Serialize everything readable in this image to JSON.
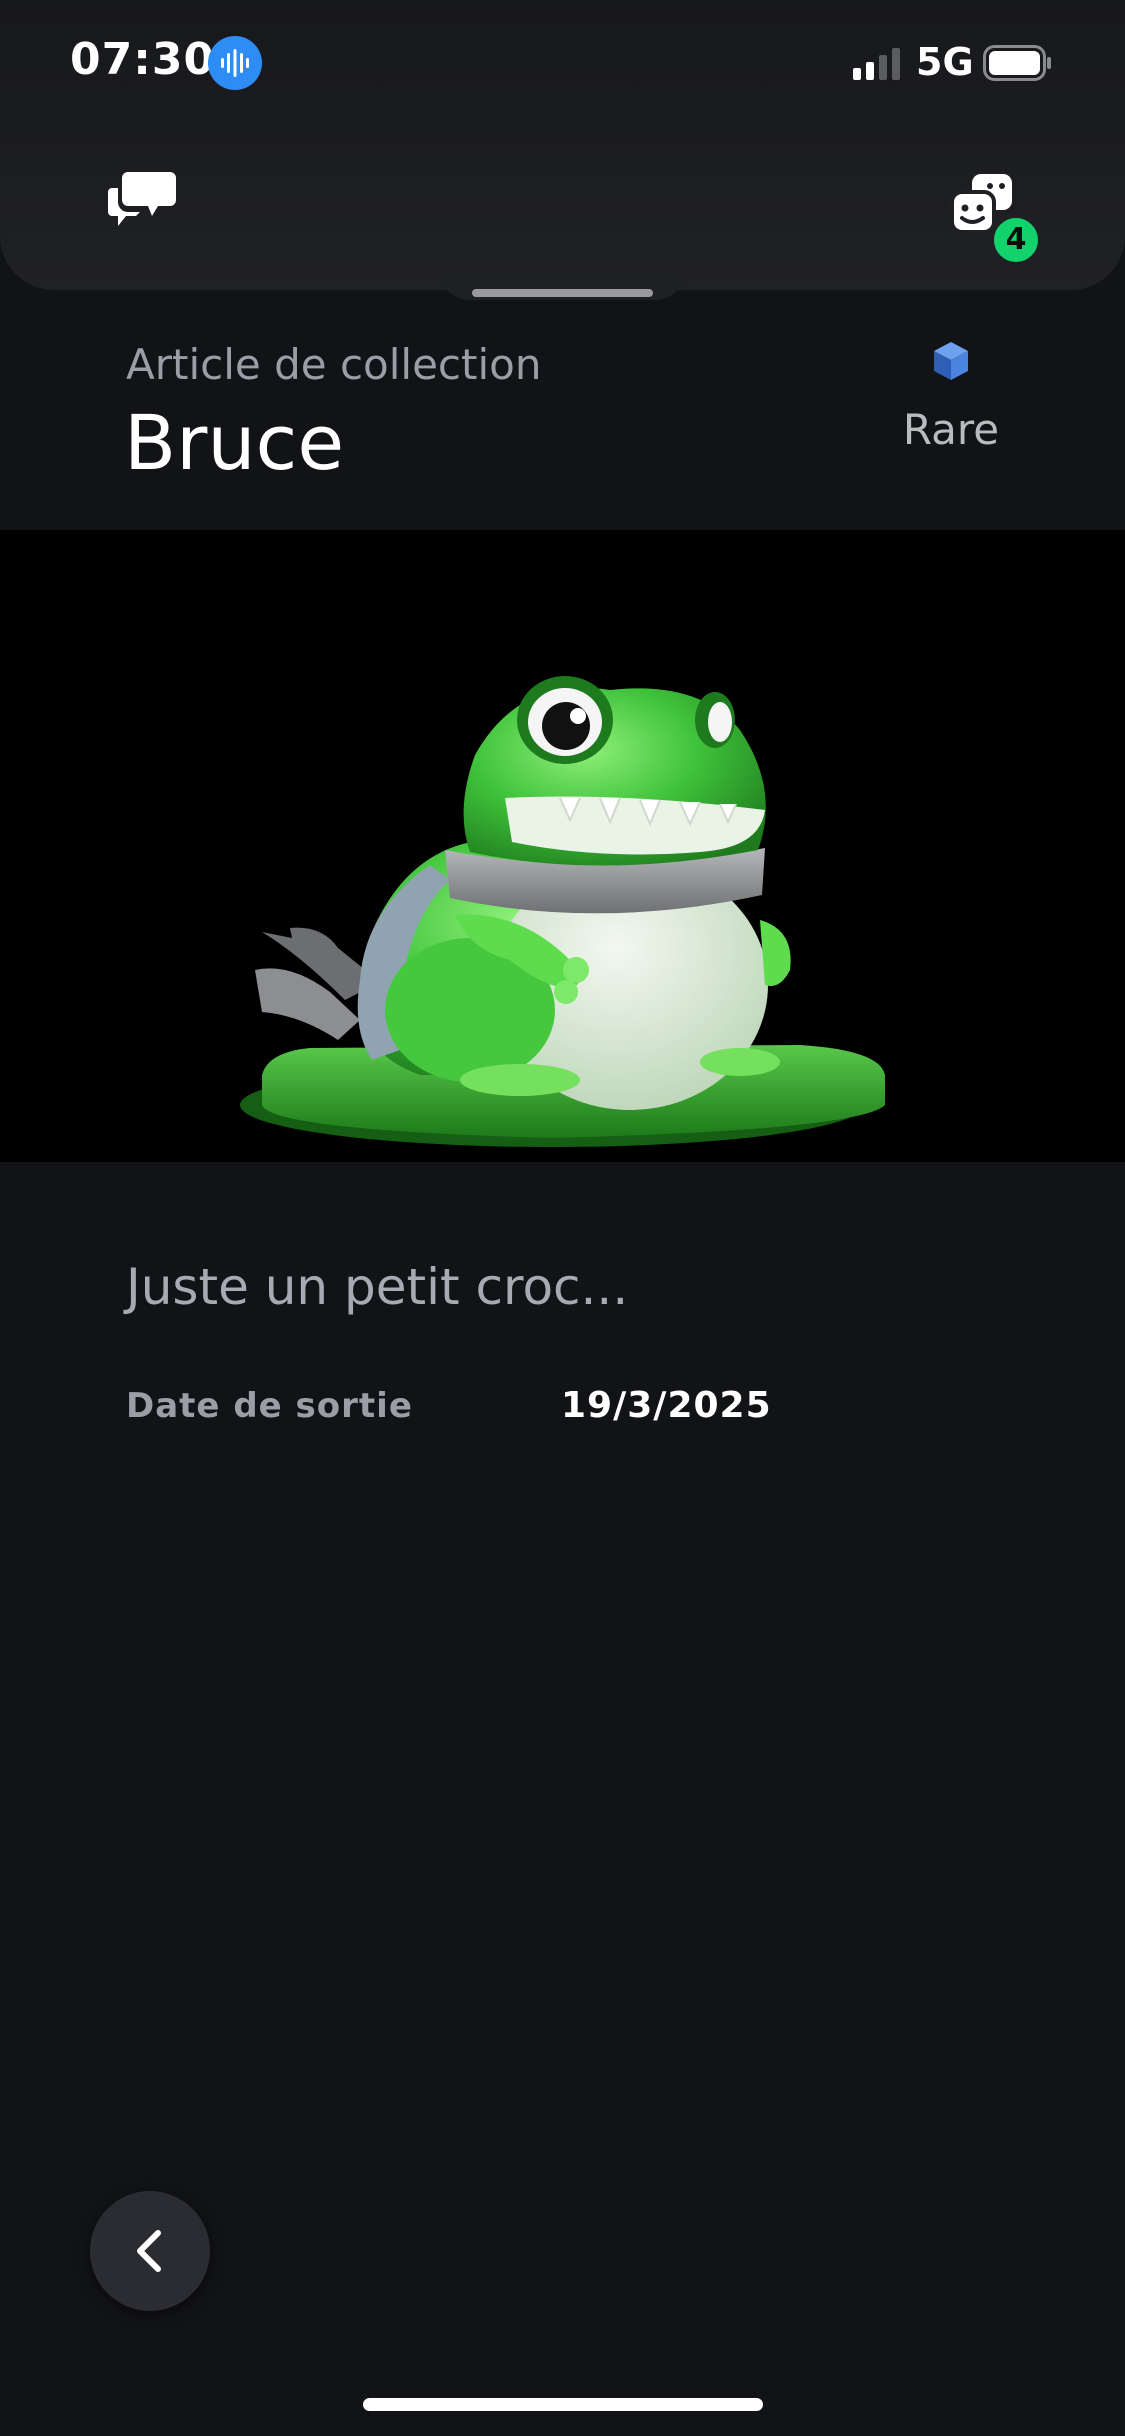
{
  "status_bar": {
    "time": "07:30",
    "network": "5G",
    "icons": [
      "voice-assistant-icon",
      "signal-icon",
      "battery-icon"
    ]
  },
  "header": {
    "left_icon": "chat-icon",
    "right_icon": "friends-icon",
    "friends_badge": "4",
    "badge_color": "#11d26b"
  },
  "item": {
    "kicker": "Article de collection",
    "name": "Bruce",
    "rarity_label": "Rare",
    "rarity_icon": "cube-icon",
    "rarity_color": "#3f7ddb",
    "image": "frog-figurine-image",
    "description": "Juste un petit croc...",
    "release_label": "Date de sortie",
    "release_value": "19/3/2025"
  },
  "navigation": {
    "back_icon": "chevron-left-icon"
  }
}
